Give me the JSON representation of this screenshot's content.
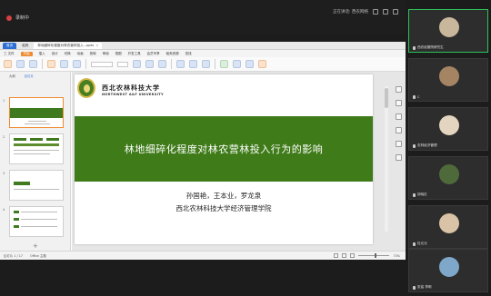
{
  "meeting": {
    "recording_label": "录制中",
    "right_text": "正在讲话: 西农网络",
    "icons": [
      "grid-icon",
      "speaker-icon",
      "expand-icon",
      "minimize-icon"
    ]
  },
  "wps": {
    "tabs": [
      {
        "label": "首页"
      },
      {
        "label": "稻壳"
      },
      {
        "label": "林地细碎化程度对林农营林投入...pptx"
      }
    ],
    "menu": [
      "三 文件",
      "开始",
      "插入",
      "设计",
      "切换",
      "动画",
      "放映",
      "审阅",
      "视图",
      "开发工具",
      "会员专享",
      "稻壳资源",
      "查找"
    ],
    "active_menu": "开始",
    "pane_tabs": [
      "大纲",
      "幻灯片"
    ],
    "pane_selected": "幻灯片",
    "thumb_numbers": [
      "1",
      "2",
      "3",
      "4"
    ],
    "status": {
      "slide_counter": "幻灯片 1 / 17",
      "theme": "Office 主题",
      "zoom": "73%"
    }
  },
  "slide": {
    "university_cn": "西北农林科技大学",
    "university_en": "NORTHWEST A&F UNIVERSITY",
    "title": "林地细碎化程度对林农营林投入行为的影响",
    "authors": "孙国艳，王本业，罗龙泉",
    "affiliation": "西北农林科技大学经济管理学院",
    "accent_color": "#3f7b19"
  },
  "participants": [
    {
      "name": "西农经管院研究生",
      "color": "#c9b79c",
      "active": true
    },
    {
      "name": "C",
      "color": "#a48463",
      "active": false
    },
    {
      "name": "农林经济管理",
      "color": "#e3d5bf",
      "active": false
    },
    {
      "name": "钟晓红",
      "color": "#4f6a3a",
      "active": false
    },
    {
      "name": "杜元元",
      "color": "#d9c2a6",
      "active": false
    },
    {
      "name": "张铭 李明",
      "color": "#7ea7c9",
      "active": false
    }
  ]
}
